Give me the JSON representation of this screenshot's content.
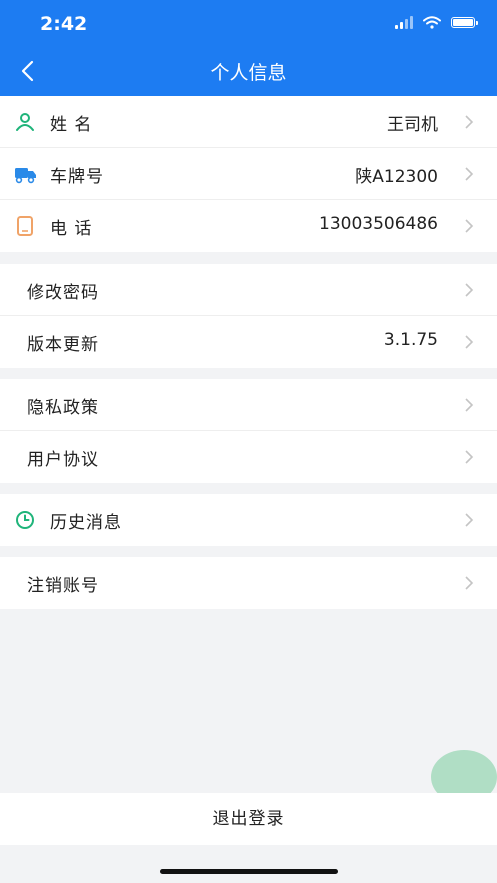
{
  "status_bar": {
    "time": "2:42"
  },
  "nav": {
    "title": "个人信息"
  },
  "profile": [
    {
      "icon": "person-icon",
      "label": "姓 名",
      "value": "王司机"
    },
    {
      "icon": "truck-icon",
      "label": "车牌号",
      "value": "陕A12300"
    },
    {
      "icon": "phone-icon",
      "label": "电 话",
      "value": "13003506486"
    }
  ],
  "settings": [
    {
      "label": "修改密码",
      "value": ""
    },
    {
      "label": "版本更新",
      "value": "3.1.75"
    }
  ],
  "legal": [
    {
      "label": "隐私政策"
    },
    {
      "label": "用户协议"
    }
  ],
  "history": {
    "icon": "clock-icon",
    "label": "历史消息"
  },
  "account": {
    "label": "注销账号"
  },
  "logout": {
    "label": "退出登录"
  },
  "colors": {
    "header": "#1d7cf2",
    "person_icon": "#1fb47a",
    "truck_icon": "#2a8ae8",
    "phone_icon": "#f0a368",
    "clock_icon": "#1fb47a"
  }
}
